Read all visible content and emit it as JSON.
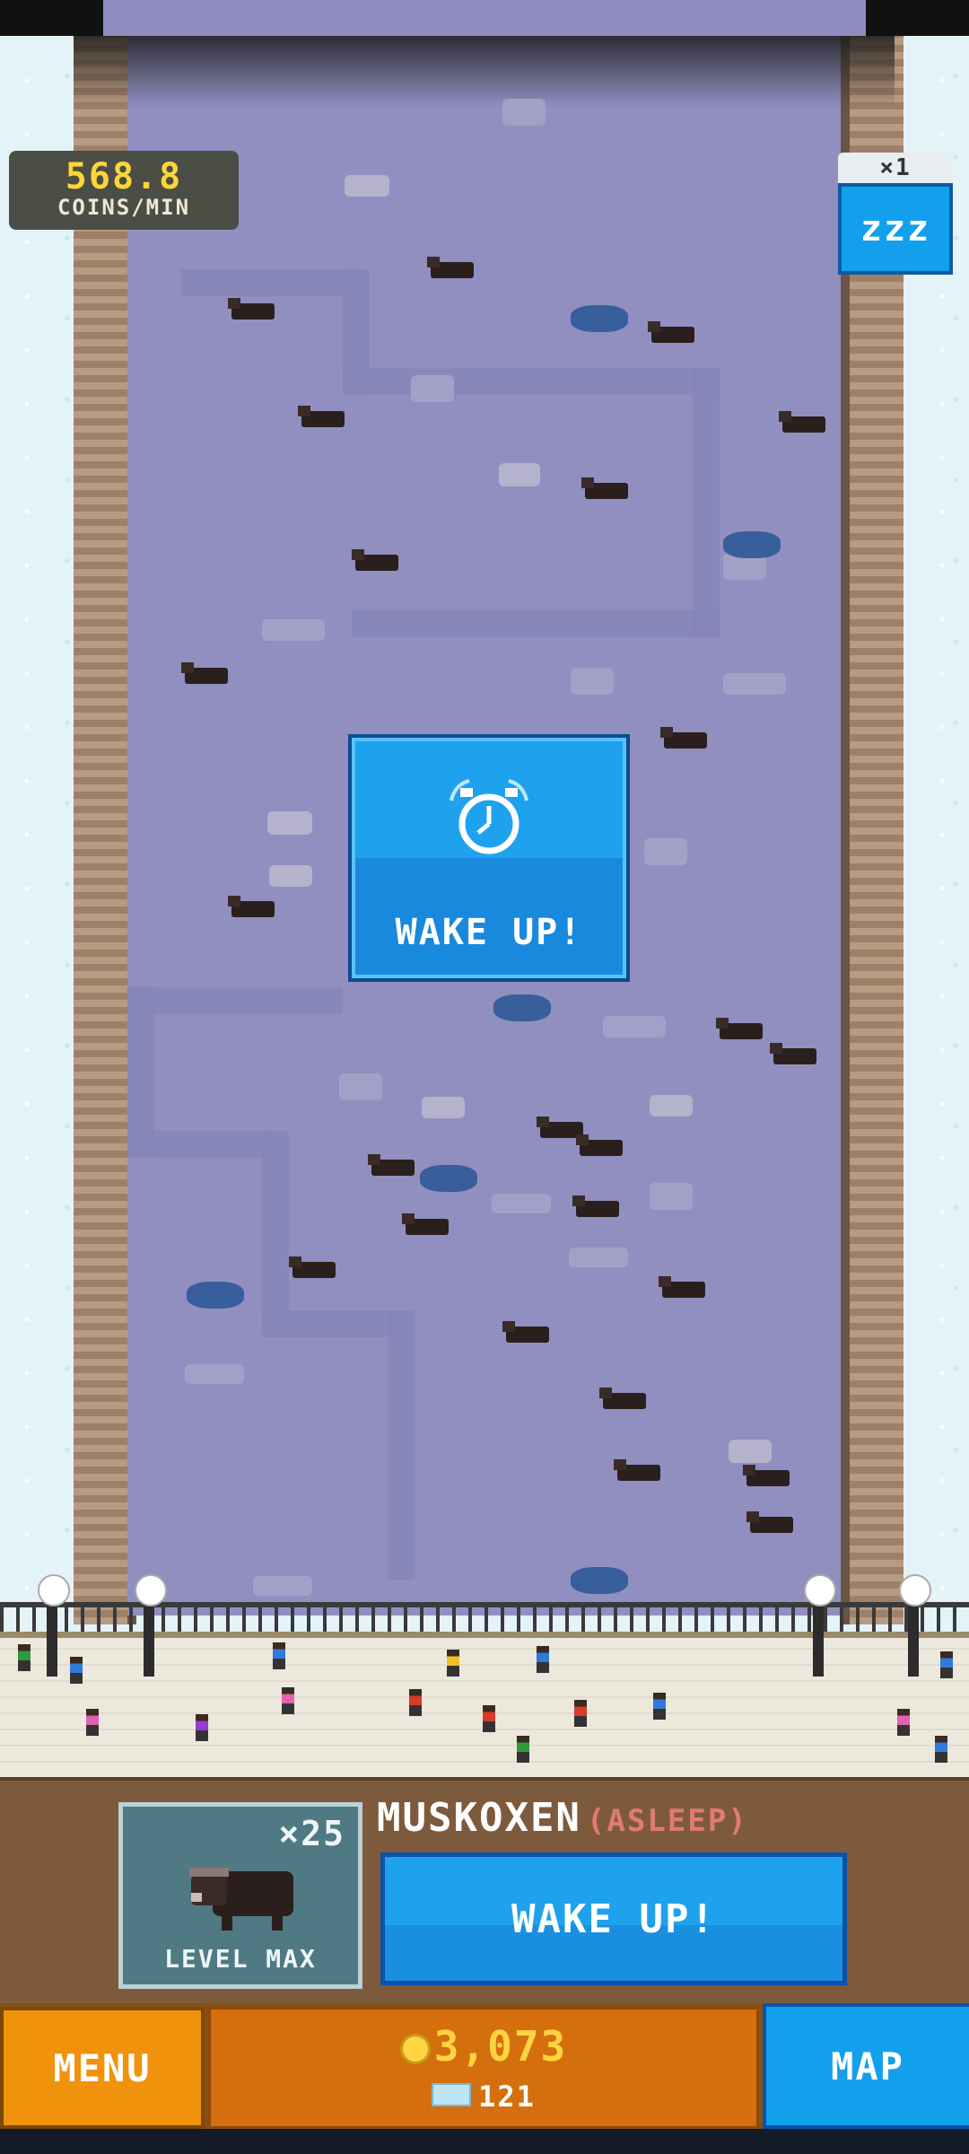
{
  "stats": {
    "rate_value": "568.8",
    "rate_unit": "COINS/MIN"
  },
  "speed": {
    "multiplier": "×1",
    "sleep_icon_text": "zzz"
  },
  "center_alert": {
    "label": "WAKE UP!",
    "icon": "alarm-clock-icon"
  },
  "animal": {
    "name": "MUSKOXEN",
    "status": "(ASLEEP)",
    "count": "×25",
    "level": "LEVEL MAX",
    "wake_button": "WAKE UP!"
  },
  "bottom_bar": {
    "menu_label": "MENU",
    "map_label": "MAP",
    "coins": "3,073",
    "gems": "121"
  },
  "colors": {
    "accent_blue": "#12a0ec",
    "menu_orange": "#f0920b",
    "coin_yellow": "#ffd440",
    "asleep_red": "#e07a74"
  }
}
